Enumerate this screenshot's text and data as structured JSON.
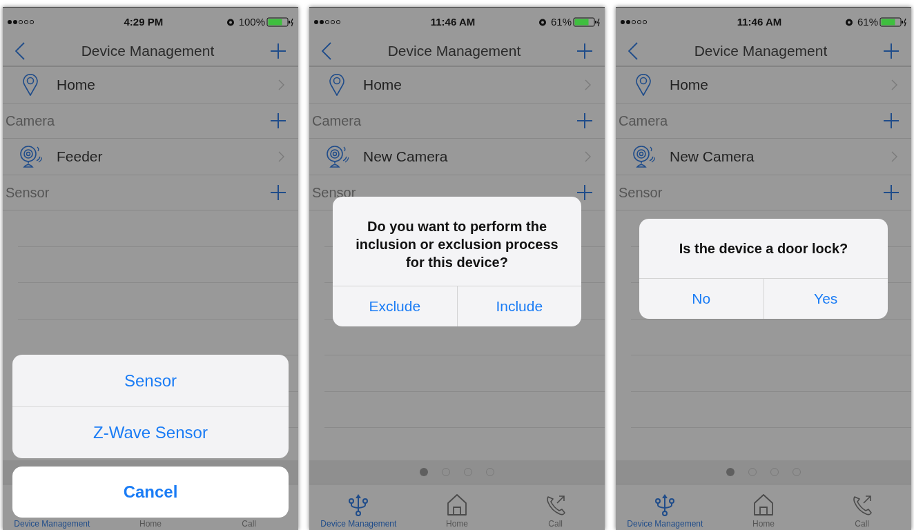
{
  "phones": [
    {
      "status_bar": {
        "time": "4:29 PM",
        "battery": "100%"
      },
      "nav": {
        "title": "Device Management"
      },
      "list": [
        {
          "kind": "location",
          "label": "Home"
        },
        {
          "kind": "section",
          "label": "Camera"
        },
        {
          "kind": "camera",
          "label": "Feeder"
        },
        {
          "kind": "section",
          "label": "Sensor"
        }
      ],
      "tabs": [
        {
          "label": "Device Management",
          "selected": true
        },
        {
          "label": "Home",
          "selected": false
        },
        {
          "label": "Call",
          "selected": false
        }
      ],
      "overlay": {
        "kind": "action_sheet",
        "options": [
          "Sensor",
          "Z-Wave Sensor"
        ],
        "cancel": "Cancel"
      }
    },
    {
      "status_bar": {
        "time": "11:46 AM",
        "battery": "61%"
      },
      "nav": {
        "title": "Device Management"
      },
      "list": [
        {
          "kind": "location",
          "label": "Home"
        },
        {
          "kind": "section",
          "label": "Camera"
        },
        {
          "kind": "camera",
          "label": "New Camera"
        },
        {
          "kind": "section",
          "label": "Sensor"
        }
      ],
      "page_dots": [
        {
          "selected": true
        },
        {
          "selected": false
        },
        {
          "selected": false
        },
        {
          "selected": false
        }
      ],
      "tabs": [
        {
          "label": "Device Management",
          "selected": true
        },
        {
          "label": "Home",
          "selected": false
        },
        {
          "label": "Call",
          "selected": false
        }
      ],
      "overlay": {
        "kind": "alert",
        "message": "Do you want to perform the inclusion or exclusion process for this device?",
        "buttons": [
          "Exclude",
          "Include"
        ]
      }
    },
    {
      "status_bar": {
        "time": "11:46 AM",
        "battery": "61%"
      },
      "nav": {
        "title": "Device Management"
      },
      "list": [
        {
          "kind": "location",
          "label": "Home"
        },
        {
          "kind": "section",
          "label": "Camera"
        },
        {
          "kind": "camera",
          "label": "New Camera"
        },
        {
          "kind": "section",
          "label": "Sensor"
        }
      ],
      "page_dots": [
        {
          "selected": true
        },
        {
          "selected": false
        },
        {
          "selected": false
        },
        {
          "selected": false
        }
      ],
      "tabs": [
        {
          "label": "Device Management",
          "selected": true
        },
        {
          "label": "Home",
          "selected": false
        },
        {
          "label": "Call",
          "selected": false
        }
      ],
      "overlay": {
        "kind": "alert",
        "message": "Is the device a door lock?",
        "buttons": [
          "No",
          "Yes"
        ]
      }
    }
  ]
}
